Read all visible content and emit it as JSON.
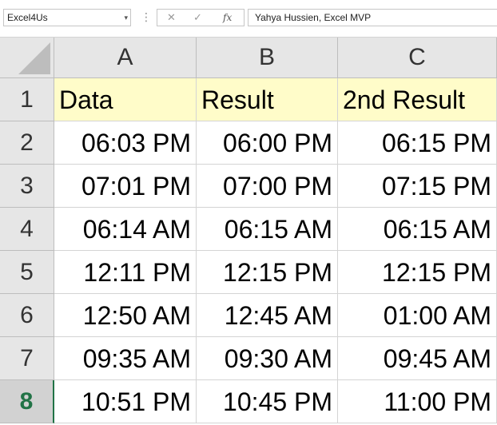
{
  "formula_bar": {
    "name_box": "Excel4Us",
    "name_box_arrow": "▾",
    "more": "⋮",
    "cancel": "✕",
    "enter": "✓",
    "fx": "fx",
    "content": "Yahya Hussien, Excel MVP"
  },
  "columns": [
    "A",
    "B",
    "C"
  ],
  "rows": [
    "1",
    "2",
    "3",
    "4",
    "5",
    "6",
    "7",
    "8"
  ],
  "header_row": [
    "Data",
    "Result",
    "2nd Result"
  ],
  "data_rows": [
    [
      "06:03 PM",
      "06:00 PM",
      "06:15 PM"
    ],
    [
      "07:01 PM",
      "07:00 PM",
      "07:15 PM"
    ],
    [
      "06:14 AM",
      "06:15 AM",
      "06:15 AM"
    ],
    [
      "12:11 PM",
      "12:15 PM",
      "12:15 PM"
    ],
    [
      "12:50 AM",
      "12:45 AM",
      "01:00 AM"
    ],
    [
      "09:35 AM",
      "09:30 AM",
      "09:45 AM"
    ],
    [
      "10:51 PM",
      "10:45 PM",
      "11:00 PM"
    ]
  ],
  "active_row": "8",
  "colors": {
    "header_fill": "#fffcc9",
    "active_accent": "#217346"
  }
}
